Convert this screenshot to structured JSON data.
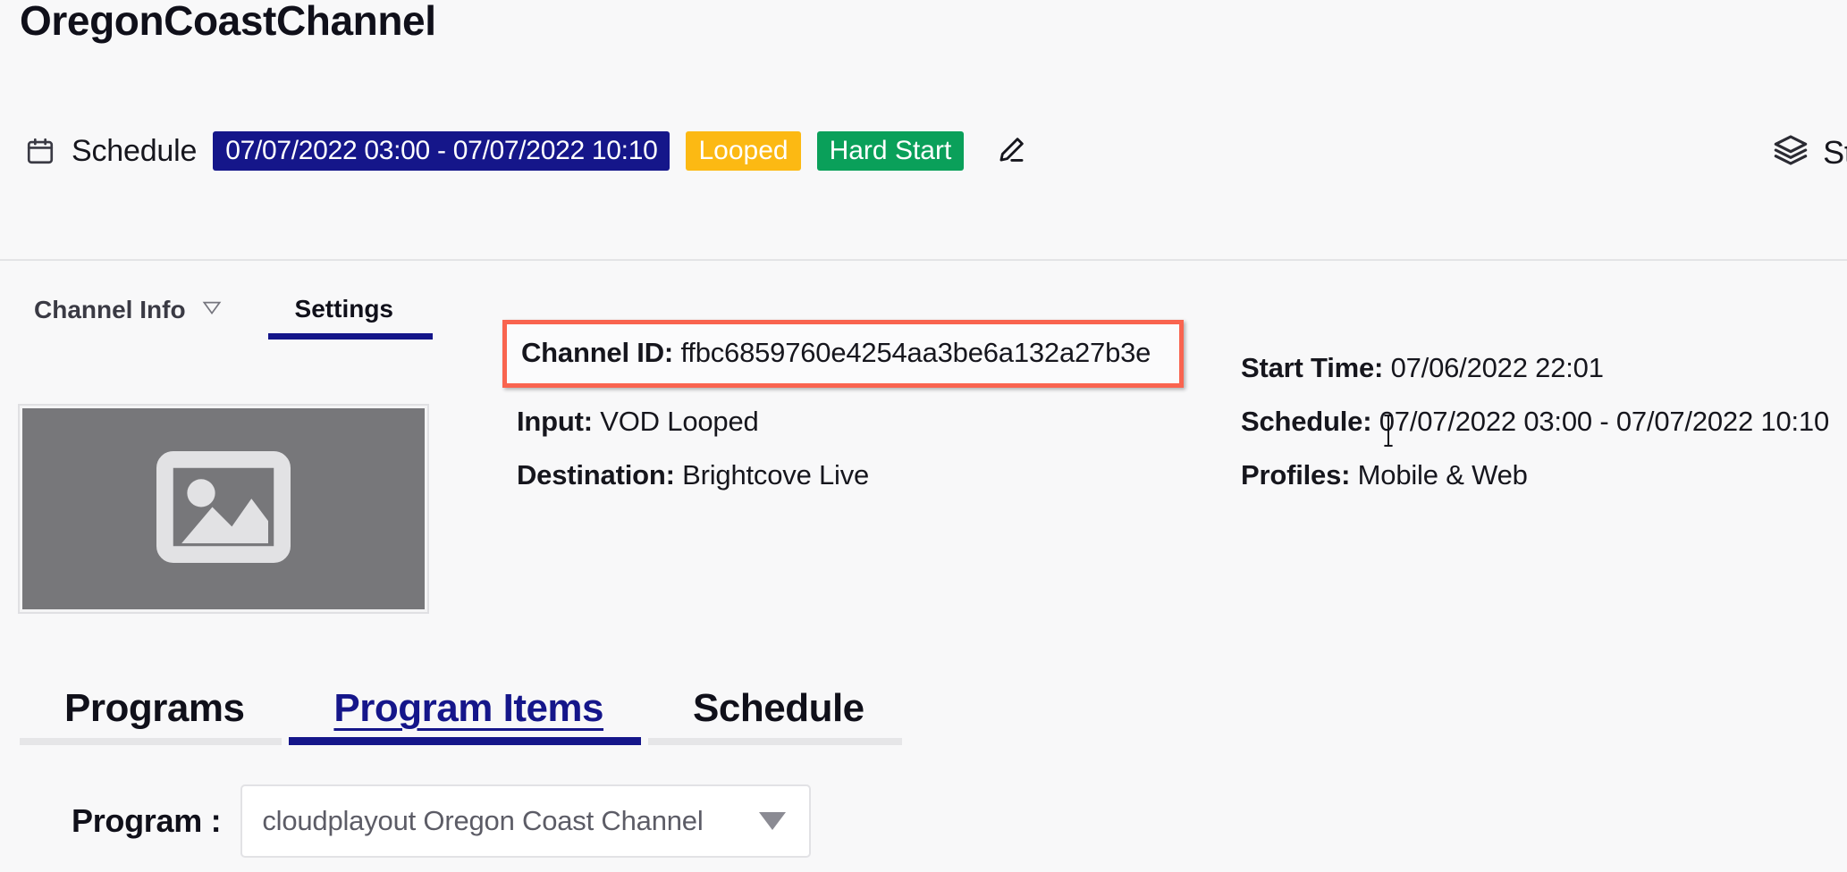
{
  "header": {
    "title": "OregonCoastChannel",
    "schedule_icon": "calendar-icon",
    "schedule_label": "Schedule",
    "schedule_range": "07/07/2022 03:00 - 07/07/2022 10:10",
    "badge_looped": "Looped",
    "badge_hard_start": "Hard Start",
    "edit_icon": "pencil-edit-icon",
    "status_icon": "layers-stack-icon",
    "status_label": "Stat"
  },
  "sub_tabs": {
    "channel_info": "Channel Info",
    "channel_info_icon": "caret-down-icon",
    "settings": "Settings"
  },
  "thumbnail": {
    "icon": "image-placeholder-icon"
  },
  "details": {
    "left": [
      {
        "label": "Channel ID:",
        "value": "ffbc6859760e4254aa3be6a132a27b3e"
      },
      {
        "label": "Input:",
        "value": "VOD Looped"
      },
      {
        "label": "Destination:",
        "value": "Brightcove Live"
      }
    ],
    "right": [
      {
        "label": "Start Time:",
        "value": "07/06/2022 22:01"
      },
      {
        "label": "Schedule:",
        "value": "07/07/2022 03:00 - 07/07/2022 10:10"
      },
      {
        "label": "Profiles:",
        "value": "Mobile & Web"
      }
    ]
  },
  "bottom_tabs": [
    {
      "label": "Programs",
      "active": false
    },
    {
      "label": "Program Items",
      "active": true
    },
    {
      "label": "Schedule",
      "active": false
    }
  ],
  "program": {
    "label": "Program :",
    "selected": "cloudplayout Oregon Coast Channel",
    "caret_icon": "caret-down-icon"
  },
  "colors": {
    "navy": "#15168a",
    "amber": "#fcb913",
    "green": "#0aa05a",
    "highlight_red": "#f9644f",
    "page_bg": "#f8f8f9"
  }
}
